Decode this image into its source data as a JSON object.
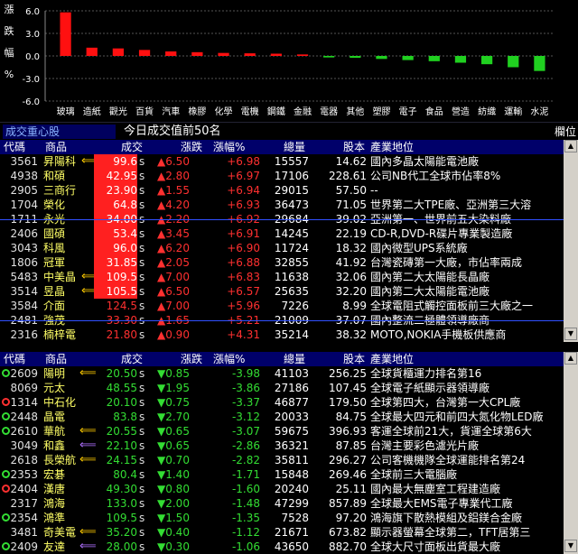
{
  "chart_data": {
    "type": "bar",
    "title": "",
    "ylabel": "漲跌幅%",
    "ylabel_chars": [
      "漲",
      "跌",
      "幅",
      "%"
    ],
    "yticks": [
      "6.0",
      "3.0",
      "0.0",
      "-3.0",
      "-6.0"
    ],
    "ylim": [
      -6,
      6
    ],
    "grid": true,
    "categories": [
      "玻璃",
      "造紙",
      "觀光",
      "百貨",
      "汽車",
      "橡膠",
      "化學",
      "電機",
      "鋼鐵",
      "金融",
      "電器",
      "其他",
      "塑膠",
      "電子",
      "食品",
      "營造",
      "紡織",
      "運輸",
      "水泥"
    ],
    "values": [
      5.8,
      1.1,
      1.0,
      0.8,
      0.6,
      0.5,
      0.4,
      0.35,
      0.3,
      0.2,
      -0.2,
      -0.25,
      -0.4,
      -0.55,
      -0.7,
      -0.9,
      -1.1,
      -1.5,
      -2.0
    ]
  },
  "title_bar": {
    "section": "成交重心股",
    "title": "今日成交值前50名",
    "column_icon": "欄位"
  },
  "columns": {
    "code": "代碼",
    "name": "商品",
    "price": "成交",
    "change": "漲跌",
    "pct": "漲幅%",
    "volume": "總量",
    "capital": "股本",
    "industry": "產業地位"
  },
  "colors": {
    "up": "#ff3030",
    "down": "#33dd33",
    "header": "#00006a",
    "name": "#ffff66"
  },
  "top_rows": [
    {
      "code": "3561",
      "name": "昇陽科",
      "arrow": "yellow",
      "price": "99.6",
      "price_box": "red",
      "s": "s",
      "chg": "▲6.50",
      "pct": "+6.98",
      "vol": "15557",
      "cap": "14.62",
      "ind": "國內多晶太陽能電池廠"
    },
    {
      "code": "4938",
      "name": "和碩",
      "arrow": "",
      "price": "42.95",
      "price_box": "red",
      "s": "s",
      "chg": "▲2.80",
      "pct": "+6.97",
      "vol": "17106",
      "cap": "228.61",
      "ind": "公司NB代工全球市佔率8%"
    },
    {
      "code": "2905",
      "name": "三商行",
      "arrow": "",
      "price": "23.90",
      "price_box": "red",
      "s": "s",
      "chg": "▲1.55",
      "pct": "+6.94",
      "vol": "29015",
      "cap": "57.50",
      "ind": "--"
    },
    {
      "code": "1704",
      "name": "榮化",
      "arrow": "",
      "price": "64.8",
      "price_box": "red",
      "s": "s",
      "chg": "▲4.20",
      "pct": "+6.93",
      "vol": "36473",
      "cap": "71.05",
      "ind": "世界第二大TPE廠、亞洲第三大溶"
    },
    {
      "code": "1711",
      "name": "永光",
      "arrow": "",
      "price": "34.00",
      "price_box": "red",
      "s": "s",
      "chg": "▲2.20",
      "pct": "+6.92",
      "vol": "29684",
      "cap": "39.02",
      "ind": "亞洲第一、世界前五大染料廠"
    },
    {
      "code": "2406",
      "name": "國碩",
      "arrow": "",
      "price": "53.4",
      "price_box": "red",
      "s": "s",
      "chg": "▲3.45",
      "pct": "+6.91",
      "vol": "14245",
      "cap": "22.19",
      "ind": "CD-R,DVD-R碟片專業製造廠"
    },
    {
      "code": "3043",
      "name": "科風",
      "arrow": "",
      "price": "96.0",
      "price_box": "red",
      "s": "s",
      "chg": "▲6.20",
      "pct": "+6.90",
      "vol": "11724",
      "cap": "18.32",
      "ind": "國內微型UPS系統廠"
    },
    {
      "code": "1806",
      "name": "冠軍",
      "arrow": "",
      "price": "31.85",
      "price_box": "red",
      "s": "s",
      "chg": "▲2.05",
      "pct": "+6.88",
      "vol": "32855",
      "cap": "41.92",
      "ind": "台灣瓷磚第一大廠，市佔率兩成"
    },
    {
      "code": "5483",
      "name": "中美晶",
      "arrow": "yellow",
      "price": "109.5",
      "price_box": "red",
      "s": "s",
      "chg": "▲7.00",
      "pct": "+6.83",
      "vol": "11638",
      "cap": "32.06",
      "ind": "國內第二大太陽能長晶廠"
    },
    {
      "code": "3514",
      "name": "昱晶",
      "arrow": "yellow",
      "price": "105.5",
      "price_box": "red",
      "s": "s",
      "chg": "▲6.50",
      "pct": "+6.57",
      "vol": "25635",
      "cap": "32.20",
      "ind": "國內第二大太陽能電池廠"
    },
    {
      "code": "3584",
      "name": "介面",
      "arrow": "",
      "price": "124.5",
      "price_box": "",
      "s": "s",
      "chg": "▲7.00",
      "pct": "+5.96",
      "vol": "7226",
      "cap": "8.99",
      "ind": "全球電阻式觸控面板前三大廠之一"
    },
    {
      "code": "2481",
      "name": "強茂",
      "arrow": "",
      "price": "33.30",
      "price_box": "",
      "s": "s",
      "chg": "▲1.65",
      "pct": "+5.21",
      "vol": "21009",
      "cap": "37.07",
      "ind": "國內整流二極體領導廠商"
    },
    {
      "code": "2316",
      "name": "楠梓電",
      "arrow": "",
      "price": "21.80",
      "price_box": "",
      "s": "s",
      "chg": "▲0.90",
      "pct": "+4.31",
      "vol": "35214",
      "cap": "38.32",
      "ind": "MOTO,NOKIA手機板供應商"
    }
  ],
  "bottom_rows": [
    {
      "code": "2609",
      "name": "陽明",
      "circle": "g",
      "arrow": "yellow",
      "price": "20.50",
      "price_box": "",
      "s": "s",
      "chg": "▼0.85",
      "pct": "-3.98",
      "vol": "41103",
      "cap": "256.25",
      "ind": "全球貨櫃運力排名第16"
    },
    {
      "code": "8069",
      "name": "元太",
      "circle": "",
      "arrow": "",
      "price": "48.55",
      "price_box": "",
      "s": "s",
      "chg": "▼1.95",
      "pct": "-3.86",
      "vol": "27186",
      "cap": "107.45",
      "ind": "全球電子紙顯示器領導廠"
    },
    {
      "code": "1314",
      "name": "中石化",
      "circle": "r",
      "arrow": "",
      "price": "20.10",
      "price_box": "",
      "s": "s",
      "chg": "▼0.75",
      "pct": "-3.37",
      "vol": "46877",
      "cap": "179.50",
      "ind": "全球第四大，台灣第一大CPL廠"
    },
    {
      "code": "2448",
      "name": "晶電",
      "circle": "g",
      "arrow": "",
      "price": "83.8",
      "price_box": "",
      "s": "s",
      "chg": "▼2.70",
      "pct": "-3.12",
      "vol": "20033",
      "cap": "84.75",
      "ind": "全球最大四元和前四大氮化物LED廠"
    },
    {
      "code": "2610",
      "name": "華航",
      "circle": "g",
      "arrow": "yellow",
      "price": "20.55",
      "price_box": "",
      "s": "s",
      "chg": "▼0.65",
      "pct": "-3.07",
      "vol": "59675",
      "cap": "396.93",
      "ind": "客運全球前21大，貨運全球第6大"
    },
    {
      "code": "3049",
      "name": "和鑫",
      "circle": "",
      "arrow": "purple",
      "price": "22.10",
      "price_box": "",
      "s": "s",
      "chg": "▼0.65",
      "pct": "-2.86",
      "vol": "36321",
      "cap": "87.85",
      "ind": "台灣主要彩色濾光片廠"
    },
    {
      "code": "2618",
      "name": "長榮航",
      "circle": "",
      "arrow": "yellow",
      "price": "24.15",
      "price_box": "",
      "s": "s",
      "chg": "▼0.70",
      "pct": "-2.82",
      "vol": "35811",
      "cap": "296.27",
      "ind": "公司客機機隊全球運能排名第24"
    },
    {
      "code": "2353",
      "name": "宏碁",
      "circle": "g",
      "arrow": "",
      "price": "80.4",
      "price_box": "",
      "s": "s",
      "chg": "▼1.40",
      "pct": "-1.71",
      "vol": "15848",
      "cap": "269.46",
      "ind": "全球前三大電腦廠"
    },
    {
      "code": "2404",
      "name": "漢唐",
      "circle": "r",
      "arrow": "",
      "price": "49.30",
      "price_box": "",
      "s": "s",
      "chg": "▼0.80",
      "pct": "-1.60",
      "vol": "20240",
      "cap": "25.11",
      "ind": "國內最大無塵室工程建造廠"
    },
    {
      "code": "2317",
      "name": "鴻海",
      "circle": "",
      "arrow": "",
      "price": "133.0",
      "price_box": "",
      "s": "s",
      "chg": "▼2.00",
      "pct": "-1.48",
      "vol": "47299",
      "cap": "857.89",
      "ind": "全球最大EMS電子專業代工廠"
    },
    {
      "code": "2354",
      "name": "鴻準",
      "circle": "g",
      "arrow": "",
      "price": "109.5",
      "price_box": "",
      "s": "s",
      "chg": "▼1.50",
      "pct": "-1.35",
      "vol": "7528",
      "cap": "97.20",
      "ind": "鴻海旗下散熱模組及鋁鎂合金廠"
    },
    {
      "code": "3481",
      "name": "奇美電",
      "circle": "",
      "arrow": "yellow",
      "price": "35.20",
      "price_box": "",
      "s": "s",
      "chg": "▼0.40",
      "pct": "-1.12",
      "vol": "21671",
      "cap": "673.82",
      "ind": "顯示器螢幕全球第二，TFT居第三"
    },
    {
      "code": "2409",
      "name": "友達",
      "circle": "g",
      "arrow": "purple",
      "price": "28.00",
      "price_box": "",
      "s": "s",
      "chg": "▼0.30",
      "pct": "-1.06",
      "vol": "43650",
      "cap": "882.70",
      "ind": "全球大尺寸面板出貨最大廠"
    }
  ]
}
